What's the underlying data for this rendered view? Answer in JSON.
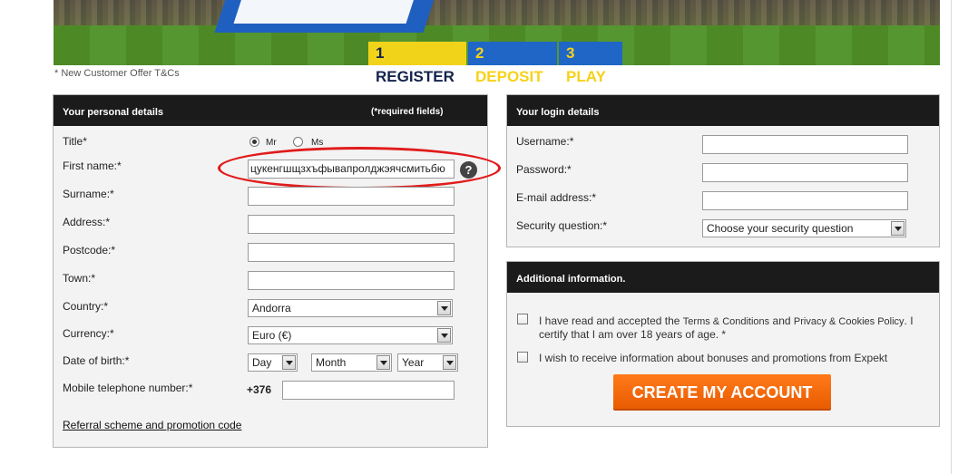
{
  "banner": {
    "steps": [
      "1 REGISTER",
      "2 DEPOSIT",
      "3 PLAY"
    ],
    "offer_note": "* New Customer Offer T&Cs"
  },
  "personal": {
    "header": "Your personal details",
    "required_note": "(*required fields)",
    "title_label": "Title*",
    "title_options": [
      "Mr",
      "Ms"
    ],
    "title_selected": "Mr",
    "first_name_label": "First name:*",
    "first_name_value": "цукенгшщзхъфывапролджэячсмитьбю",
    "help_icon": "?",
    "surname_label": "Surname:*",
    "address_label": "Address:*",
    "postcode_label": "Postcode:*",
    "town_label": "Town:*",
    "country_label": "Country:*",
    "country_value": "Andorra",
    "currency_label": "Currency:*",
    "currency_value": "Euro (€)",
    "dob_label": "Date of birth:*",
    "dob_day": "Day",
    "dob_month": "Month",
    "dob_year": "Year",
    "mobile_label": "Mobile telephone number:*",
    "mobile_prefix": "+376",
    "referral_link": "Referral scheme and promotion code"
  },
  "login": {
    "header": "Your login details",
    "username_label": "Username:*",
    "password_label": "Password:*",
    "email_label": "E-mail address:*",
    "security_label": "Security question:*",
    "security_value": "Choose your security question"
  },
  "additional": {
    "header": "Additional information.",
    "terms_prefix": "I have read and accepted the",
    "terms_link": "Terms & Conditions",
    "terms_and": "and",
    "privacy_link": "Privacy & Cookies Policy",
    "terms_suffix": ". I",
    "terms_line2": "certify that I am over 18 years of age. *",
    "bonus_text": "I wish to receive information about bonuses and promotions from Expekt",
    "create_button": "CREATE MY ACCOUNT"
  },
  "colors": {
    "accent_orange": "#f26a0c",
    "step_yellow": "#f1d41a",
    "step_blue": "#1f66c6",
    "annotation_red": "#e11b1b"
  }
}
